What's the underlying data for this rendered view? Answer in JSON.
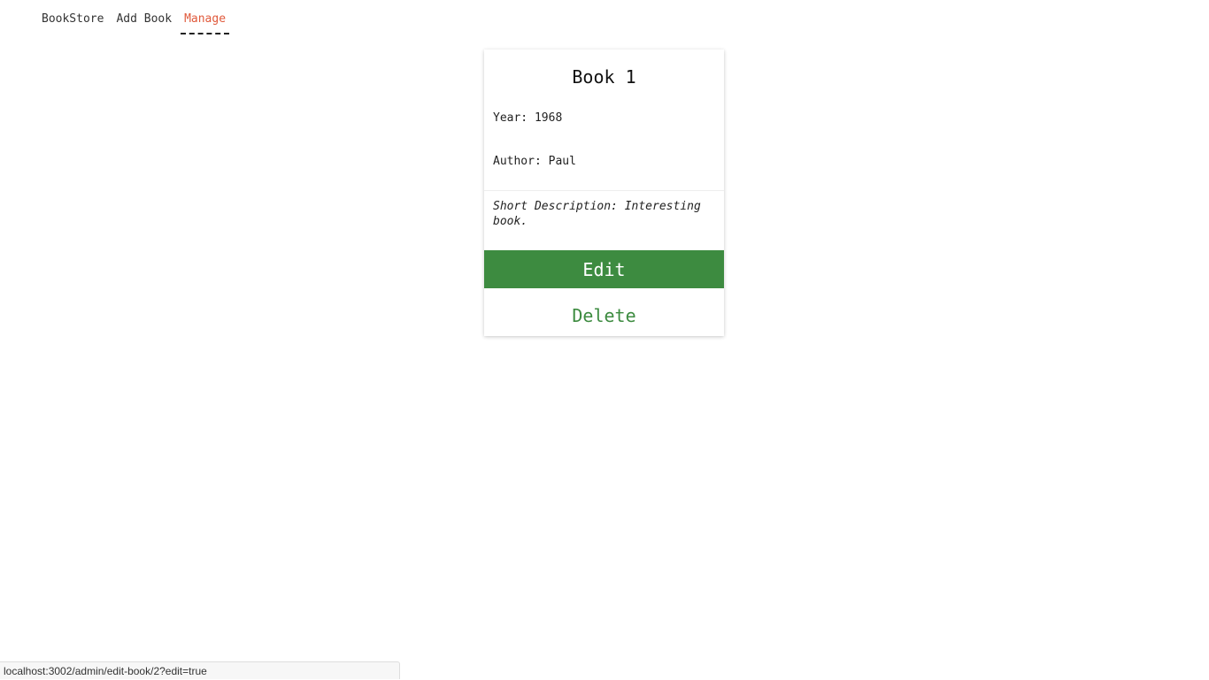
{
  "nav": {
    "items": [
      {
        "label": "BookStore"
      },
      {
        "label": "Add Book"
      },
      {
        "label": "Manage"
      }
    ]
  },
  "book": {
    "title": "Book 1",
    "year": "Year: 1968",
    "author": "Author: Paul",
    "description": "Short Description: Interesting book."
  },
  "actions": {
    "edit_label": "Edit",
    "delete_label": "Delete"
  },
  "status_bar": {
    "url": "localhost:3002/admin/edit-book/2?edit=true"
  },
  "colors": {
    "accent_green": "#3d8b40",
    "active_nav": "#e05a3c"
  }
}
